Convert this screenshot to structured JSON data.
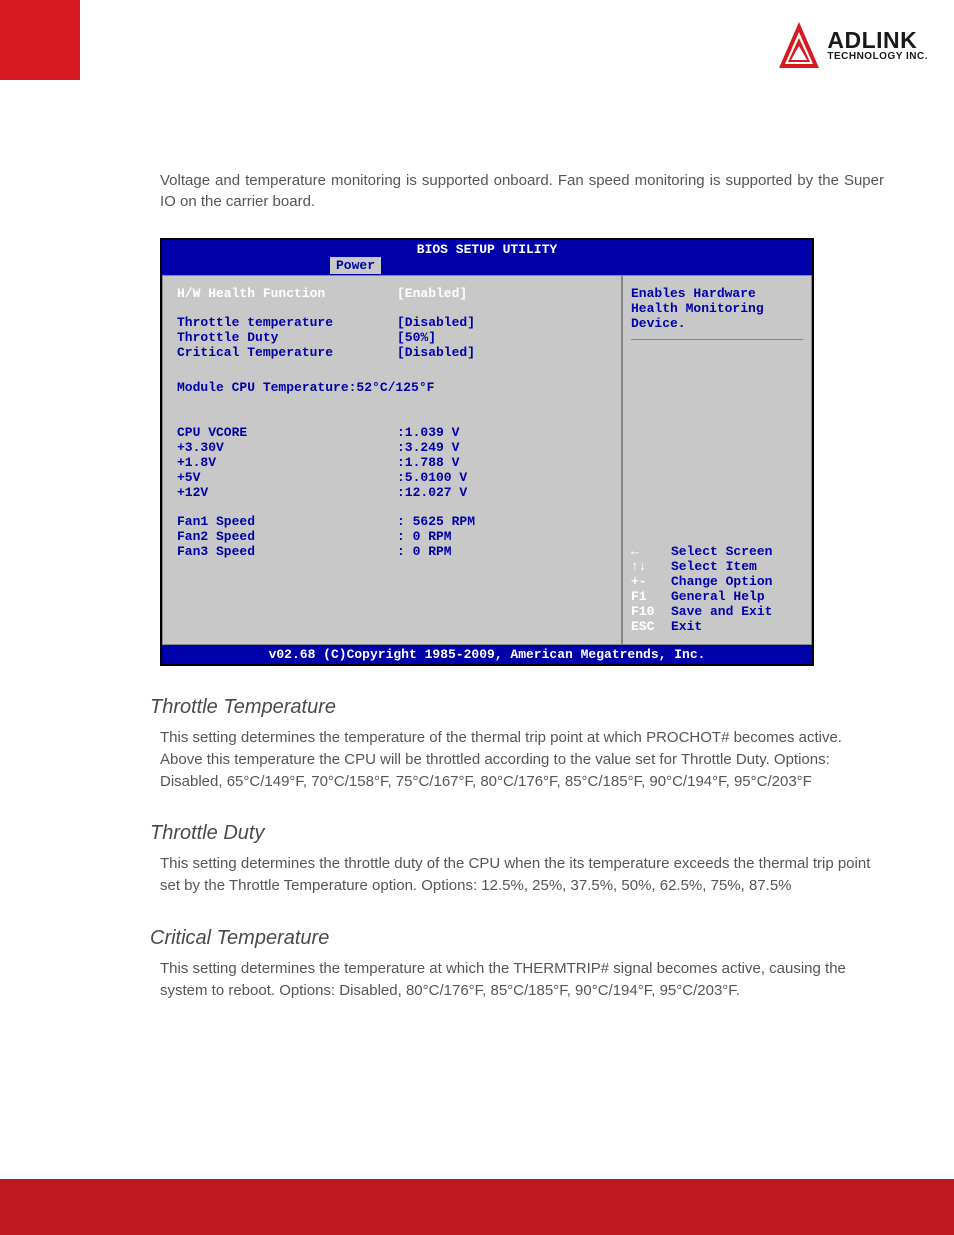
{
  "logo": {
    "line1": "ADLINK",
    "line2": "TECHNOLOGY INC."
  },
  "intro": "Voltage and temperature monitoring is supported onboard. Fan speed monitoring is supported by the Super IO on the carrier board.",
  "bios": {
    "title": "BIOS SETUP UTILITY",
    "tab": "Power",
    "firstRow": {
      "label": "H/W Health Function",
      "value": "[Enabled]"
    },
    "settings": [
      {
        "label": "Throttle temperature",
        "value": "[Disabled]"
      },
      {
        "label": "Throttle Duty",
        "value": "[50%]"
      },
      {
        "label": "Critical Temperature",
        "value": "[Disabled]"
      }
    ],
    "moduleTemp": "Module CPU Temperature:52°C/125°F",
    "voltages": [
      {
        "label": "CPU VCORE",
        "value": ":1.039 V"
      },
      {
        "label": "+3.30V",
        "value": ":3.249 V"
      },
      {
        "label": "+1.8V",
        "value": ":1.788 V"
      },
      {
        "label": "+5V",
        "value": ":5.0100 V"
      },
      {
        "label": "+12V",
        "value": ":12.027 V"
      }
    ],
    "fans": [
      {
        "label": "Fan1 Speed",
        "value": ": 5625 RPM"
      },
      {
        "label": "Fan2 Speed",
        "value": ": 0 RPM"
      },
      {
        "label": "Fan3 Speed",
        "value": ": 0 RPM"
      }
    ],
    "sideTop": [
      "Enables Hardware",
      "Health Monitoring",
      "Device."
    ],
    "helpKeys": [
      {
        "key": "←",
        "text": "Select Screen"
      },
      {
        "key": "↑↓",
        "text": "Select Item"
      },
      {
        "key": "+-",
        "text": "Change Option"
      },
      {
        "key": "F1",
        "text": "General Help"
      },
      {
        "key": "F10",
        "text": "Save and Exit"
      },
      {
        "key": "ESC",
        "text": "Exit"
      }
    ],
    "footer": "v02.68 (C)Copyright 1985-2009, American Megatrends, Inc."
  },
  "sections": [
    {
      "heading": "Throttle Temperature",
      "body": "This setting determines the temperature of the thermal trip point at which PROCHOT# becomes active. Above this temperature the CPU will be throttled according to the value set for Throttle Duty. Options: Disabled, 65°C/149°F, 70°C/158°F, 75°C/167°F, 80°C/176°F, 85°C/185°F,  90°C/194°F, 95°C/203°F"
    },
    {
      "heading": "Throttle Duty",
      "body": "This setting determines the throttle duty of the CPU when the its temperature exceeds the thermal trip point set by the Throttle Temperature option. Options: 12.5%, 25%, 37.5%, 50%, 62.5%, 75%, 87.5%"
    },
    {
      "heading": "Critical Temperature",
      "body": "This setting determines the temperature at which the THERMTRIP# signal becomes active, causing the system to reboot. Options: Disabled, 80°C/176°F, 85°C/185°F, 90°C/194°F, 95°C/203°F."
    }
  ]
}
